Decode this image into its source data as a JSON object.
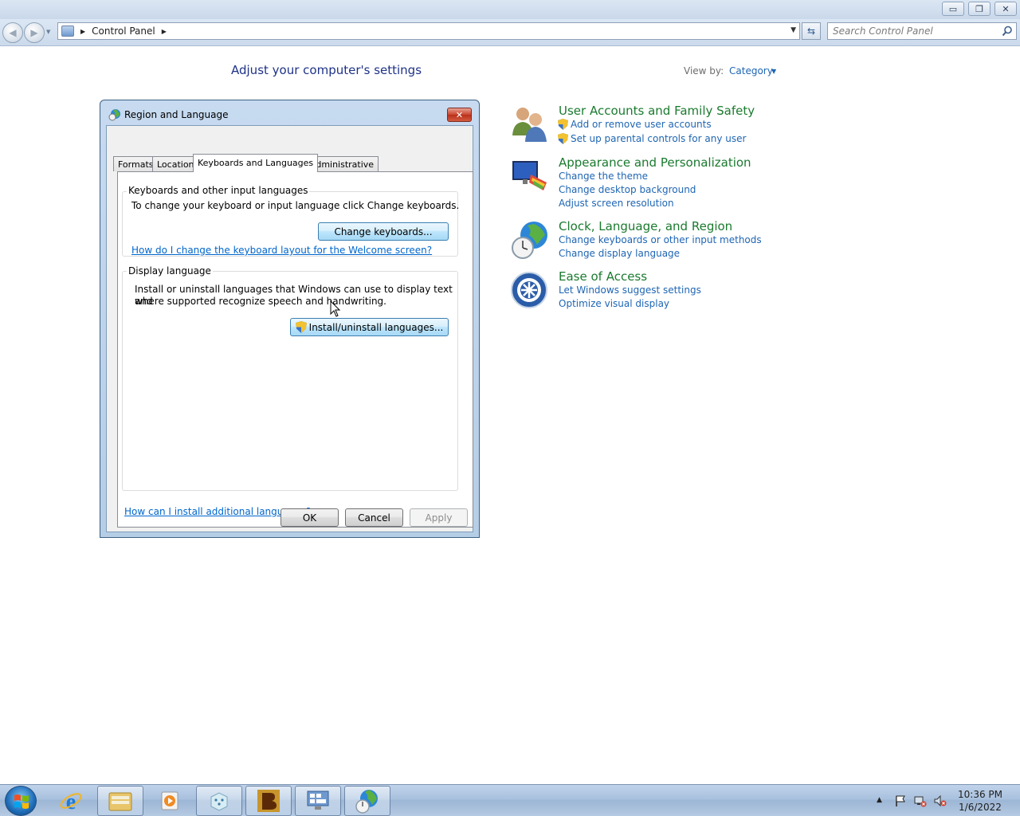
{
  "window": {
    "caption_minimize": "▭",
    "caption_restore": "❐",
    "caption_close": "✕"
  },
  "address_bar": {
    "crumb": "Control Panel",
    "search_placeholder": "Search Control Panel"
  },
  "control_panel": {
    "heading": "Adjust your computer's settings",
    "view_by_label": "View by:",
    "view_by_value": "Category",
    "categories": [
      {
        "title": "User Accounts and Family Safety",
        "links": [
          "Add or remove user accounts",
          "Set up parental controls for any user"
        ]
      },
      {
        "title": "Appearance and Personalization",
        "links": [
          "Change the theme",
          "Change desktop background",
          "Adjust screen resolution"
        ]
      },
      {
        "title": "Clock, Language, and Region",
        "links": [
          "Change keyboards or other input methods",
          "Change display language"
        ]
      },
      {
        "title": "Ease of Access",
        "links": [
          "Let Windows suggest settings",
          "Optimize visual display"
        ]
      }
    ]
  },
  "dialog": {
    "title": "Region and Language",
    "close_label": "✕",
    "tabs": [
      "Formats",
      "Location",
      "Keyboards and Languages",
      "Administrative"
    ],
    "active_tab": "Keyboards and Languages",
    "keyboards_group": {
      "label": "Keyboards and other input languages",
      "description": "To change your keyboard or input language click Change keyboards.",
      "button": "Change keyboards...",
      "link": "How do I change the keyboard layout for the Welcome screen?"
    },
    "display_group": {
      "label": "Display language",
      "description_line1": "Install or uninstall languages that Windows can use to display text and",
      "description_line2": "where supported recognize speech and handwriting.",
      "button": "Install/uninstall languages..."
    },
    "bottom_link": "How can I install additional languages?",
    "ok": "OK",
    "cancel": "Cancel",
    "apply": "Apply"
  },
  "taskbar": {
    "time": "10:36 PM",
    "date": "1/6/2022",
    "pinned": [
      "internet-explorer",
      "windows-explorer",
      "media-player",
      "game",
      "app",
      "control-panel",
      "region-language"
    ]
  },
  "colors": {
    "category_title": "#1a7a2e",
    "link_blue": "#1e65b3",
    "heading_blue": "#1e3287"
  }
}
